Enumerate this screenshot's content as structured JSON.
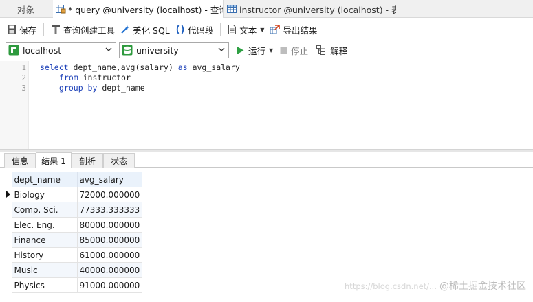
{
  "tabs": {
    "objects": "对象",
    "query": "* query @university (localhost) - 查询",
    "instructor": "instructor @university (localhost) - 表"
  },
  "toolbar": {
    "save": "保存",
    "query_builder": "查询创建工具",
    "beautify": "美化 SQL",
    "snippet": "代码段",
    "text": "文本",
    "export": "导出结果"
  },
  "connection": {
    "server": "localhost",
    "database": "university",
    "run": "运行",
    "stop": "停止",
    "explain": "解释"
  },
  "editor": {
    "line_numbers": [
      "1",
      "2",
      "3"
    ],
    "lines": [
      {
        "kw1": "select",
        "rest1": " dept_name,avg(salary) ",
        "kw2": "as",
        "rest2": " avg_salary"
      },
      {
        "kw1": "from",
        "rest1": " instructor"
      },
      {
        "kw1": "group by",
        "rest1": " dept_name"
      }
    ]
  },
  "result_tabs": [
    "信息",
    "结果 1",
    "剖析",
    "状态"
  ],
  "result_active_tab": 1,
  "grid": {
    "headers": [
      "dept_name",
      "avg_salary"
    ],
    "rows": [
      [
        "Biology",
        "72000.000000"
      ],
      [
        "Comp. Sci.",
        "77333.333333"
      ],
      [
        "Elec. Eng.",
        "80000.000000"
      ],
      [
        "Finance",
        "85000.000000"
      ],
      [
        "History",
        "61000.000000"
      ],
      [
        "Music",
        "40000.000000"
      ],
      [
        "Physics",
        "91000.000000"
      ]
    ]
  },
  "watermark": {
    "url": "https://blog.csdn.net/...",
    "brand": "@稀土掘金技术社区"
  },
  "colors": {
    "keyword": "#1b3fb8",
    "header_bg": "#eaf2fb",
    "run_green": "#2ea043"
  }
}
